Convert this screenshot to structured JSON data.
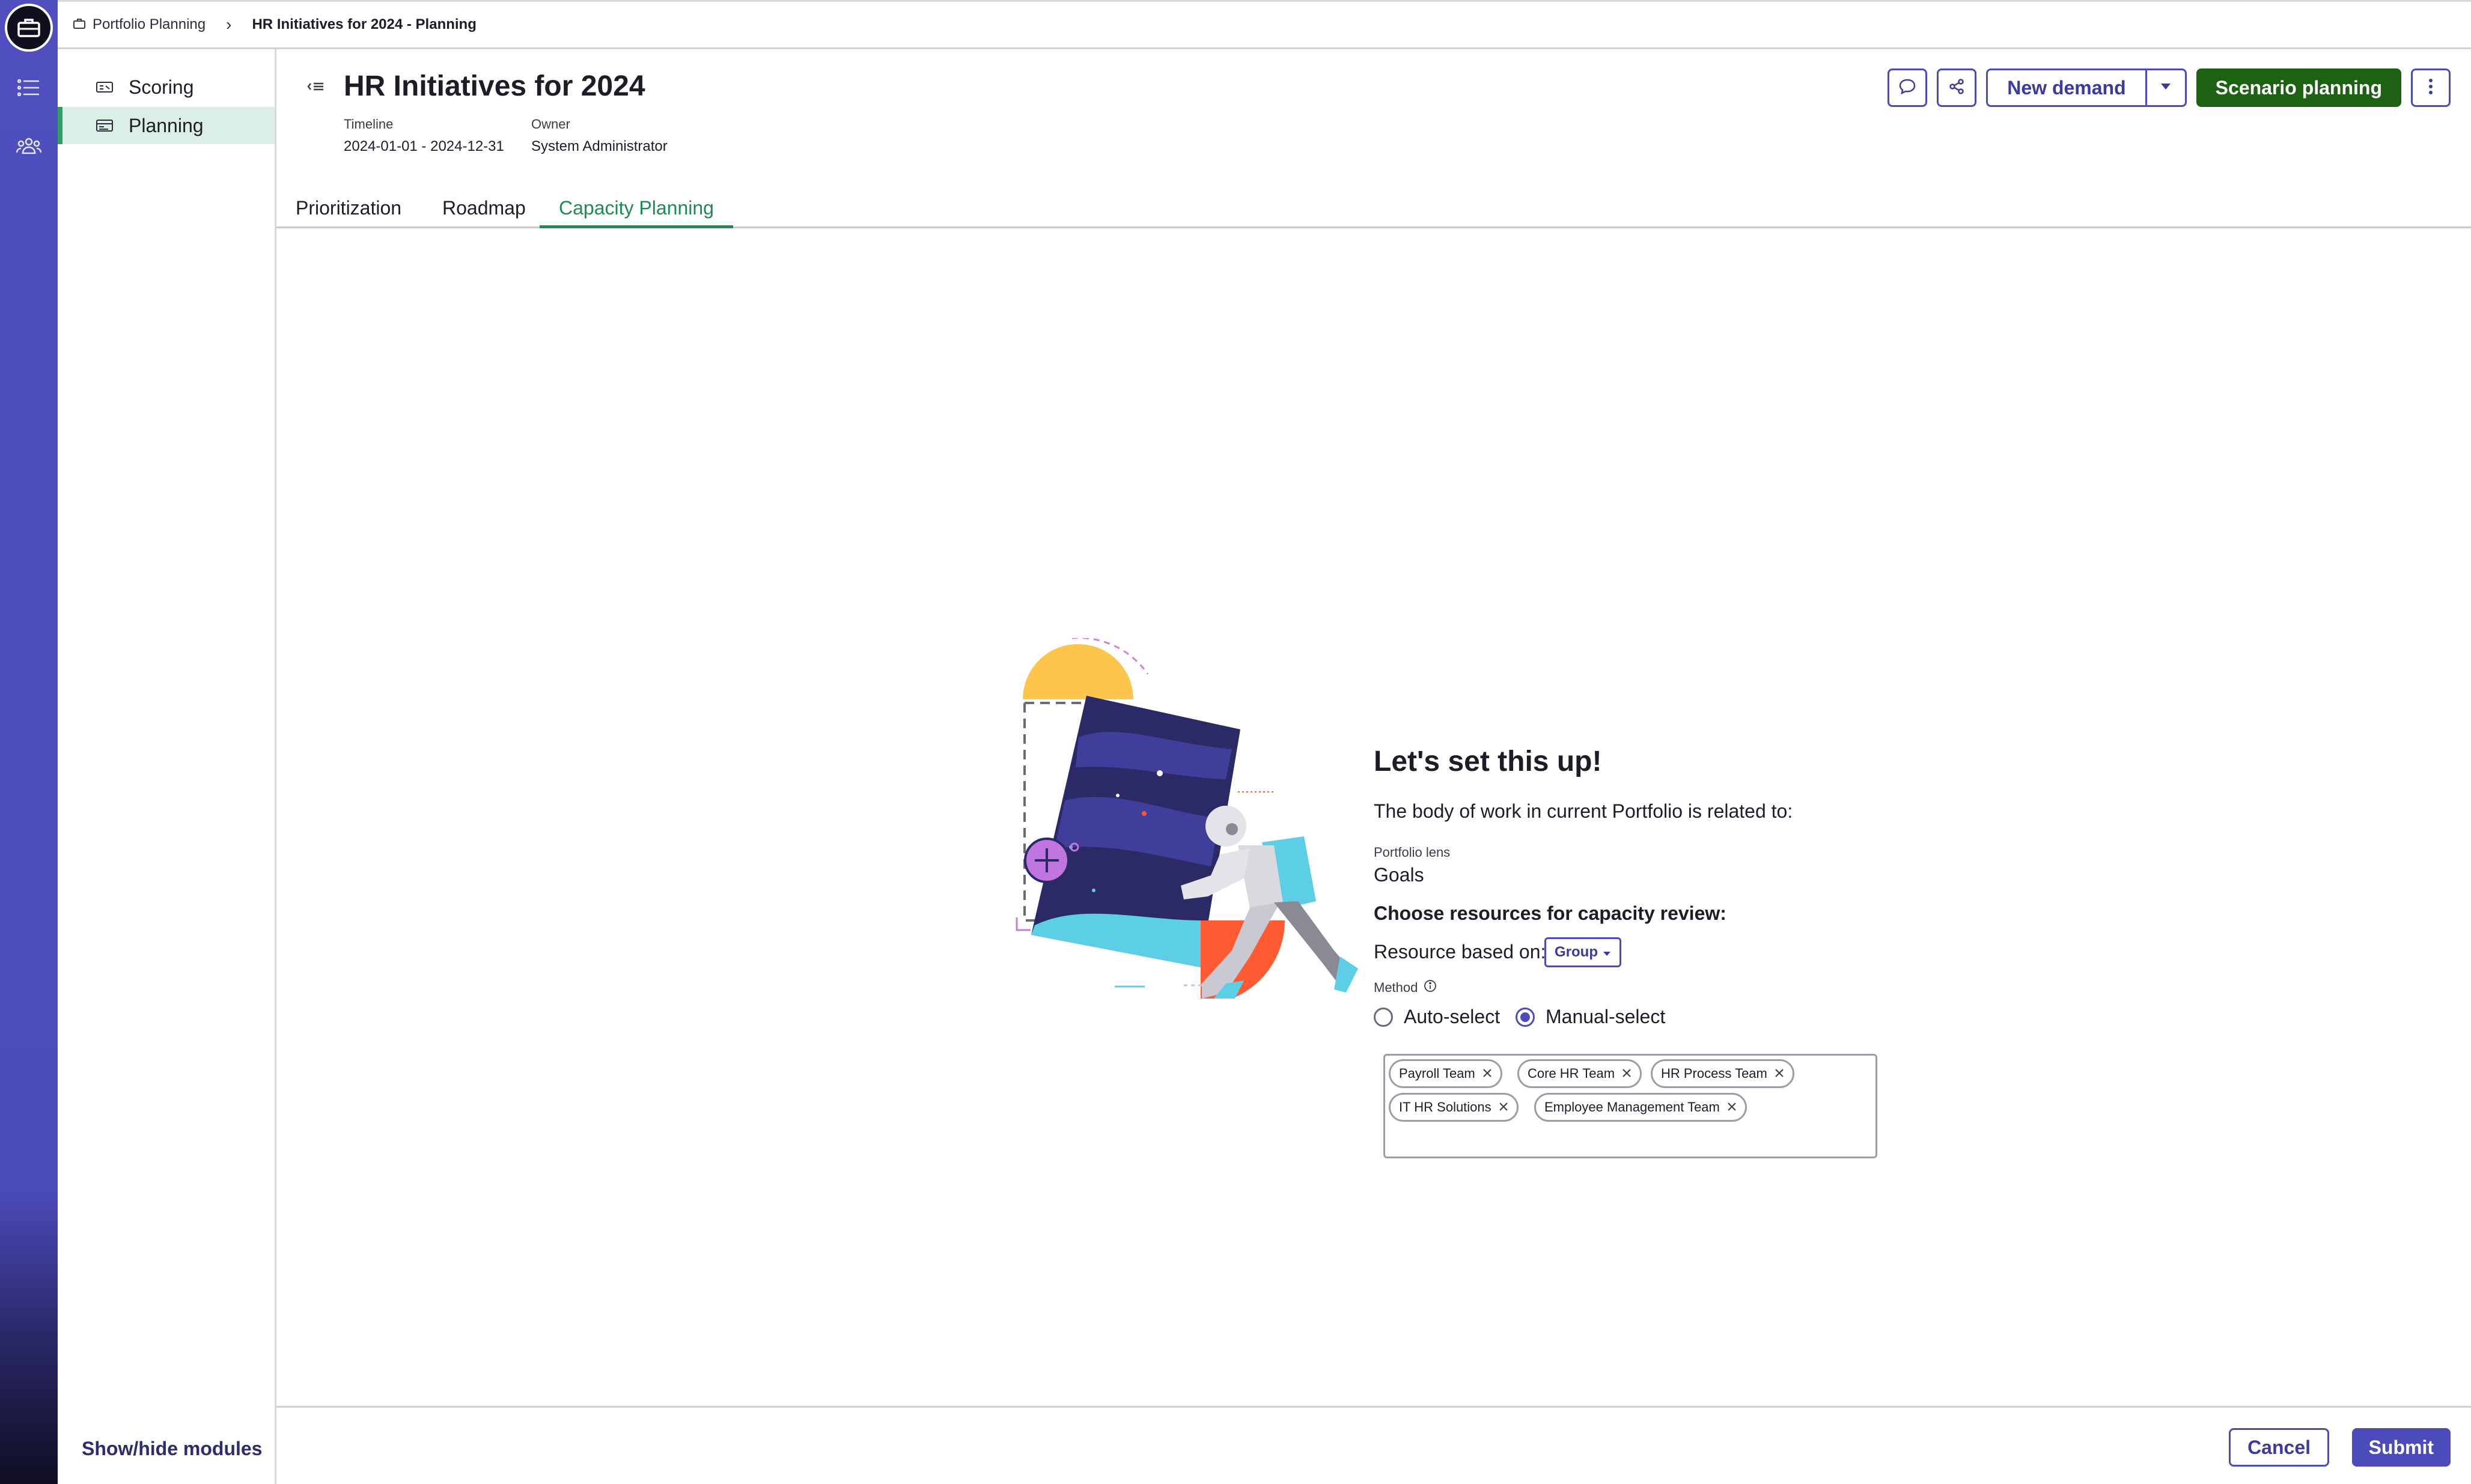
{
  "breadcrumb": {
    "root": "Portfolio Planning",
    "current": "HR Initiatives for 2024 - Planning"
  },
  "modules": [
    {
      "label": "Scoring",
      "icon": "scoring-icon",
      "active": false
    },
    {
      "label": "Planning",
      "icon": "planning-icon",
      "active": true
    }
  ],
  "show_hide": "Show/hide modules",
  "header": {
    "title": "HR Initiatives for 2024",
    "timeline_label": "Timeline",
    "timeline_value": "2024-01-01 - 2024-12-31",
    "owner_label": "Owner",
    "owner_value": "System Administrator",
    "new_demand": "New demand",
    "scenario_planning": "Scenario planning"
  },
  "tabs": [
    {
      "label": "Prioritization",
      "active": false
    },
    {
      "label": "Roadmap",
      "active": false
    },
    {
      "label": "Capacity Planning",
      "active": true
    }
  ],
  "setup": {
    "heading": "Let's set this up!",
    "intro": "The body of work in current Portfolio is related to:",
    "lens_label": "Portfolio lens",
    "lens_value": "Goals",
    "choose": "Choose resources for capacity review:",
    "resource_based_on": "Resource based on:",
    "resource_option": "Group",
    "method_label": "Method",
    "method_options": [
      {
        "label": "Auto-select",
        "selected": false
      },
      {
        "label": "Manual-select",
        "selected": true
      }
    ],
    "selected_groups": [
      "Payroll Team",
      "Core HR Team",
      "HR Process Team",
      "IT HR Solutions",
      "Employee Management Team"
    ]
  },
  "footer": {
    "cancel": "Cancel",
    "submit": "Submit"
  },
  "colors": {
    "accent": "#4b4bbb",
    "primary_green": "#1c6212",
    "active_tab": "#1f8a54",
    "active_module_bg": "#dcefe6"
  }
}
